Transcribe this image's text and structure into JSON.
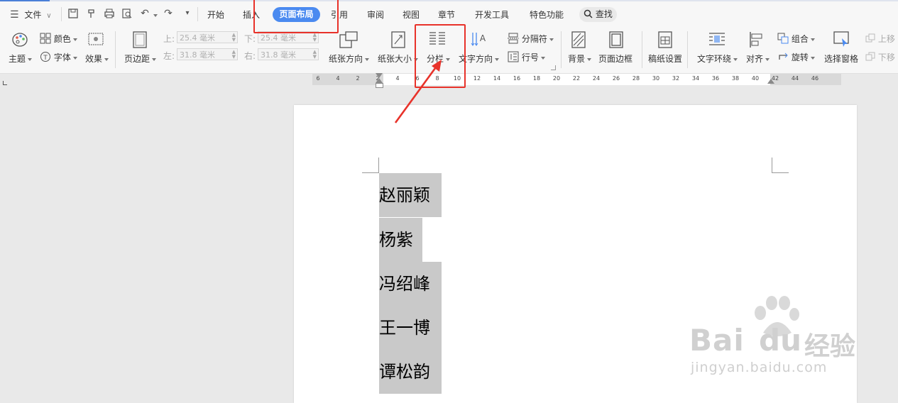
{
  "menubar": {
    "file_label": "文件",
    "tabs": [
      "开始",
      "插入",
      "页面布局",
      "引用",
      "审阅",
      "视图",
      "章节",
      "开发工具",
      "特色功能"
    ],
    "active_tab": "页面布局",
    "search_label": "查找"
  },
  "ribbon": {
    "theme": "主题",
    "color": "颜色",
    "font": "字体",
    "effect": "效果",
    "margins": "页边距",
    "margin_top_label": "上:",
    "margin_top_value": "25.4 毫米",
    "margin_left_label": "左:",
    "margin_left_value": "31.8 毫米",
    "margin_bottom_label": "下:",
    "margin_bottom_value": "25.4 毫米",
    "margin_right_label": "右:",
    "margin_right_value": "31.8 毫米",
    "orientation": "纸张方向",
    "size": "纸张大小",
    "columns": "分栏",
    "text_direction": "文字方向",
    "breaks": "分隔符",
    "line_numbers": "行号",
    "background": "背景",
    "page_borders": "页面边框",
    "manuscript": "稿纸设置",
    "wrap_text": "文字环绕",
    "align": "对齐",
    "group": "组合",
    "rotate": "旋转",
    "selection_pane": "选择窗格",
    "bring_forward": "上移",
    "send_backward": "下移"
  },
  "ruler": {
    "ticks": [
      "6",
      "4",
      "2",
      "2",
      "4",
      "6",
      "8",
      "10",
      "12",
      "14",
      "16",
      "18",
      "20",
      "22",
      "24",
      "26",
      "28",
      "30",
      "32",
      "34",
      "36",
      "38",
      "40",
      "42",
      "44",
      "46"
    ]
  },
  "document": {
    "names": [
      "赵丽颖",
      "杨紫",
      "冯绍峰",
      "王一博",
      "谭松韵"
    ]
  },
  "watermark": {
    "brand_latin": "Bai",
    "brand_du": "du",
    "brand_cn": "经验",
    "url": "jingyan.baidu.com"
  },
  "colors": {
    "accent": "#4a8af0",
    "highlight_box": "#e8322a",
    "selection": "#c9c9c9"
  }
}
